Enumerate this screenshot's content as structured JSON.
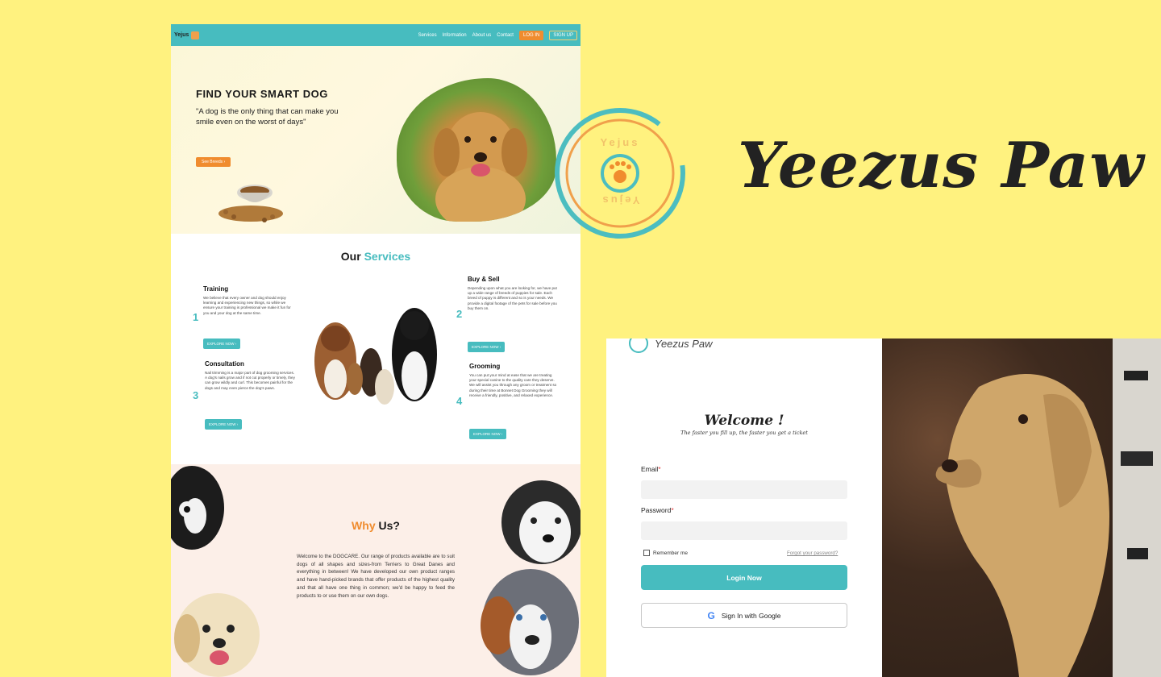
{
  "site": {
    "nav": {
      "logo_text": "Yejus",
      "links": [
        "Services",
        "Information",
        "About us",
        "Contact"
      ],
      "login_label": "LOG IN",
      "signup_label": "SIGN UP"
    },
    "hero": {
      "title": "FIND YOUR SMART DOG",
      "quote": "\"A dog is the only thing that can make you smile even on the worst of days\"",
      "button_label": "See Breeds  ›"
    },
    "services": {
      "title_plain": "Our ",
      "title_accent": "Services",
      "items": [
        {
          "number": "1",
          "name": "Training",
          "text": "We believe that every owner and dog should enjoy learning and experiencing new things, so while we ensure your training is professional we make it fun for you and your dog at the same time.",
          "button": "EXPLORE NOW  ›"
        },
        {
          "number": "2",
          "name": "Buy & Sell",
          "text": "Depending upon what you are looking for, we have put up a wide range of breeds of puppies for sale. Each breed of puppy is different and so is your needs. We provide a digital footage of the pets for sale before you buy them on.",
          "button": "EXPLORE NOW  ›"
        },
        {
          "number": "3",
          "name": "Consultation",
          "text": "Nail trimming is a major part of dog grooming services. A dog's nails grow and if not cut properly or timely, they can grow wildly and curl. This becomes painful for the dogs and may even pierce the dog's paws.",
          "button": "EXPLORE NOW  ›"
        },
        {
          "number": "4",
          "name": "Grooming",
          "text": "You can put your mind at ease that we are treating your special canine to the quality care they deserve. We will assist you through any groom or treatment so during their time at Bonnet Dog Grooming they will receive a friendly, positive, and relaxed experience.",
          "button": "EXPLORE NOW  ›"
        }
      ]
    },
    "why": {
      "title_accent": "Why",
      "title_plain": " Us?",
      "text": "Welcome to the DOGCARE. Our range of products available are to suit dogs of all shapes and sizes-from Terriers to Great Danes and everything in between! We have developed our own product ranges and have hand-picked brands that offer products of the highest quality and that all have one thing in common; we'd be happy to feed the products to or use them on our own dogs."
    }
  },
  "brand": {
    "badge_text_top": "Yejus",
    "badge_text_bottom": "Yejus",
    "name": "Yeezus Paw"
  },
  "login": {
    "logo_text": "Yeezus Paw",
    "welcome": "Welcome !",
    "subtitle": "The faster you fill up, the faster you get a ticket",
    "email_label": "Email",
    "password_label": "Password",
    "required_mark": "*",
    "remember_label": "Remember me",
    "forgot_label": "Forgot your password?",
    "login_button": "Login Now",
    "google_button": "Sign In with Google",
    "google_glyph": "G"
  },
  "colors": {
    "background": "#fff27f",
    "teal": "#47bcbf",
    "orange": "#f08c2e",
    "why_bg": "#fcefe8"
  }
}
